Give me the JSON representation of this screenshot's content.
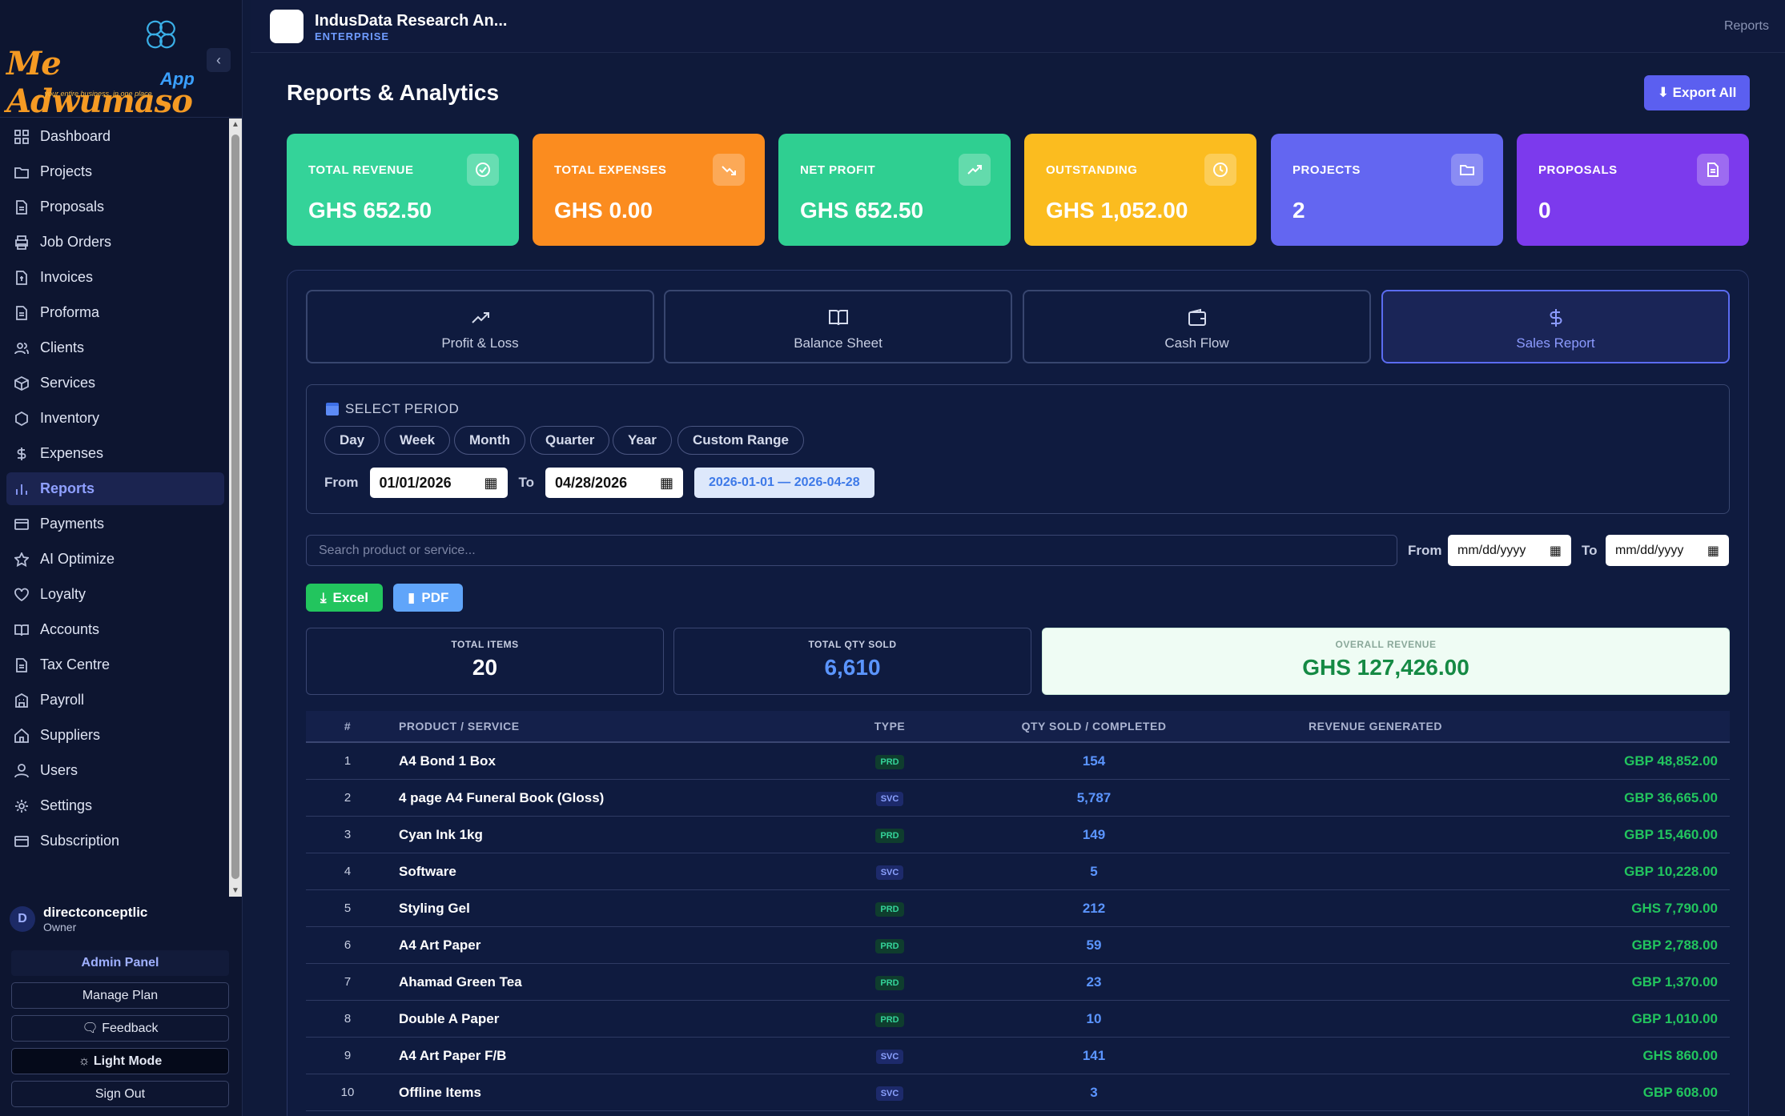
{
  "sidebar": {
    "logo_text": "Me Adwumaso",
    "logo_app": "App",
    "logo_tagline": "...your entire business, in one place",
    "items": [
      {
        "label": "Dashboard",
        "icon": "grid-icon"
      },
      {
        "label": "Projects",
        "icon": "folder-icon"
      },
      {
        "label": "Proposals",
        "icon": "document-icon"
      },
      {
        "label": "Job Orders",
        "icon": "printer-icon"
      },
      {
        "label": "Invoices",
        "icon": "invoice-icon"
      },
      {
        "label": "Proforma",
        "icon": "document-icon"
      },
      {
        "label": "Clients",
        "icon": "users-icon"
      },
      {
        "label": "Services",
        "icon": "box-icon"
      },
      {
        "label": "Inventory",
        "icon": "hexagon-icon"
      },
      {
        "label": "Expenses",
        "icon": "dollar-icon"
      },
      {
        "label": "Reports",
        "icon": "bar-chart-icon",
        "active": true
      },
      {
        "label": "Payments",
        "icon": "credit-card-icon"
      },
      {
        "label": "AI Optimize",
        "icon": "star-icon"
      },
      {
        "label": "Loyalty",
        "icon": "heart-icon"
      },
      {
        "label": "Accounts",
        "icon": "book-icon"
      },
      {
        "label": "Tax Centre",
        "icon": "document-icon"
      },
      {
        "label": "Payroll",
        "icon": "building-icon"
      },
      {
        "label": "Suppliers",
        "icon": "home-icon"
      },
      {
        "label": "Users",
        "icon": "user-icon"
      },
      {
        "label": "Settings",
        "icon": "gear-icon"
      },
      {
        "label": "Subscription",
        "icon": "card-icon"
      }
    ],
    "user": {
      "initial": "D",
      "name": "directconceptlic",
      "role": "Owner"
    },
    "admin_panel": "Admin Panel",
    "manage_plan": "Manage Plan",
    "feedback": "Feedback",
    "light_mode": "Light Mode",
    "sign_out": "Sign Out"
  },
  "topbar": {
    "org_name": "IndusData Research An...",
    "org_tier": "ENTERPRISE",
    "breadcrumb": "Reports"
  },
  "main": {
    "title": "Reports & Analytics",
    "export_all": "⬇ Export All",
    "stats": [
      {
        "label": "TOTAL REVENUE",
        "value": "GHS 652.50",
        "color": "#34d399",
        "icon": "check-circle-icon"
      },
      {
        "label": "TOTAL EXPENSES",
        "value": "GHS 0.00",
        "color": "#fb8c1f",
        "icon": "trending-down-icon"
      },
      {
        "label": "NET PROFIT",
        "value": "GHS 652.50",
        "color": "#2fcf91",
        "icon": "trending-up-icon"
      },
      {
        "label": "OUTSTANDING",
        "value": "GHS 1,052.00",
        "color": "#fbbc1f",
        "icon": "clock-icon"
      },
      {
        "label": "PROJECTS",
        "value": "2",
        "color": "#6366f1",
        "icon": "folder-icon"
      },
      {
        "label": "PROPOSALS",
        "value": "0",
        "color": "#7c3aed",
        "icon": "file-icon"
      }
    ],
    "tabs": [
      {
        "label": "Profit & Loss",
        "icon": "trending-up-icon"
      },
      {
        "label": "Balance Sheet",
        "icon": "book-open-icon"
      },
      {
        "label": "Cash Flow",
        "icon": "wallet-icon"
      },
      {
        "label": "Sales Report",
        "icon": "dollar-icon",
        "active": true
      }
    ],
    "period": {
      "title": "SELECT PERIOD",
      "chips": [
        "Day",
        "Week",
        "Month",
        "Quarter",
        "Year",
        "Custom Range"
      ],
      "from_label": "From",
      "to_label": "To",
      "from_value": "01/01/2026",
      "to_value": "04/28/2026",
      "range": "2026-01-01 — 2026-04-28"
    },
    "filter": {
      "search_placeholder": "Search product or service...",
      "from_label": "From",
      "to_label": "To",
      "from_placeholder": "mm/dd/yyyy",
      "to_placeholder": "mm/dd/yyyy"
    },
    "export_excel": "Excel",
    "export_pdf": "PDF",
    "summary": {
      "total_items_label": "TOTAL ITEMS",
      "total_items": "20",
      "total_qty_label": "TOTAL QTY SOLD",
      "total_qty": "6,610",
      "overall_revenue_label": "OVERALL REVENUE",
      "overall_revenue": "GHS 127,426.00"
    },
    "table": {
      "headers": [
        "#",
        "PRODUCT / SERVICE",
        "TYPE",
        "QTY SOLD / COMPLETED",
        "REVENUE GENERATED"
      ],
      "rows": [
        {
          "n": "1",
          "name": "A4 Bond 1 Box",
          "type": "PRD",
          "qty": "154",
          "rev": "GBP 48,852.00"
        },
        {
          "n": "2",
          "name": "4 page A4 Funeral Book (Gloss)",
          "type": "SVC",
          "qty": "5,787",
          "rev": "GBP 36,665.00"
        },
        {
          "n": "3",
          "name": "Cyan Ink 1kg",
          "type": "PRD",
          "qty": "149",
          "rev": "GBP 15,460.00"
        },
        {
          "n": "4",
          "name": "Software",
          "type": "SVC",
          "qty": "5",
          "rev": "GBP 10,228.00"
        },
        {
          "n": "5",
          "name": "Styling Gel",
          "type": "PRD",
          "qty": "212",
          "rev": "GHS 7,790.00"
        },
        {
          "n": "6",
          "name": "A4 Art Paper",
          "type": "PRD",
          "qty": "59",
          "rev": "GBP 2,788.00"
        },
        {
          "n": "7",
          "name": "Ahamad Green Tea",
          "type": "PRD",
          "qty": "23",
          "rev": "GBP 1,370.00"
        },
        {
          "n": "8",
          "name": "Double A Paper",
          "type": "PRD",
          "qty": "10",
          "rev": "GBP 1,010.00"
        },
        {
          "n": "9",
          "name": "A4 Art Paper F/B",
          "type": "SVC",
          "qty": "141",
          "rev": "GHS 860.00"
        },
        {
          "n": "10",
          "name": "Offline Items",
          "type": "SVC",
          "qty": "3",
          "rev": "GBP 608.00"
        }
      ]
    }
  }
}
